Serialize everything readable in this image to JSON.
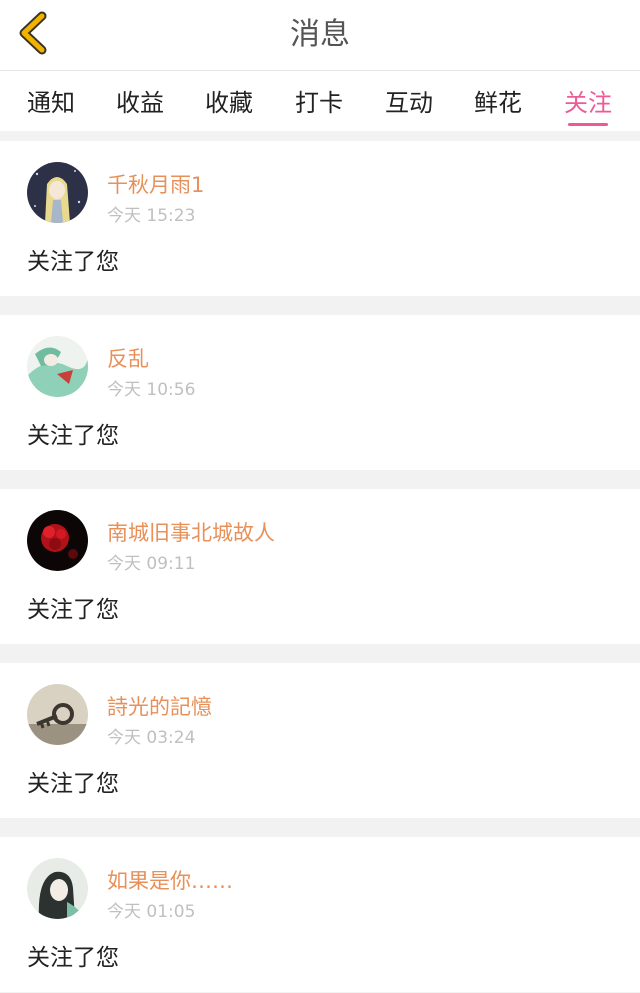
{
  "header": {
    "title": "消息",
    "back_icon": "chevron-left-icon",
    "accent_color": "#f0b400"
  },
  "tabs": [
    {
      "label": "通知",
      "active": false
    },
    {
      "label": "收益",
      "active": false
    },
    {
      "label": "收藏",
      "active": false
    },
    {
      "label": "打卡",
      "active": false
    },
    {
      "label": "互动",
      "active": false
    },
    {
      "label": "鲜花",
      "active": false
    },
    {
      "label": "关注",
      "active": true
    }
  ],
  "colors": {
    "active_tab": "#ee5a98",
    "username": "#e8905a",
    "timestamp": "#c0c0c0"
  },
  "notifications": [
    {
      "name": "千秋月雨1",
      "time": "今天 15:23",
      "message": "关注了您",
      "avatar": "anime-girl-night-avatar"
    },
    {
      "name": "反乱",
      "time": "今天 10:56",
      "message": "关注了您",
      "avatar": "green-illustration-avatar"
    },
    {
      "name": "南城旧事北城故人",
      "time": "今天 09:11",
      "message": "关注了您",
      "avatar": "red-flower-avatar"
    },
    {
      "name": "詩光的記憶",
      "time": "今天 03:24",
      "message": "关注了您",
      "avatar": "old-key-avatar"
    },
    {
      "name": "如果是你……",
      "time": "今天 01:05",
      "message": "关注了您",
      "avatar": "ink-portrait-avatar"
    }
  ]
}
